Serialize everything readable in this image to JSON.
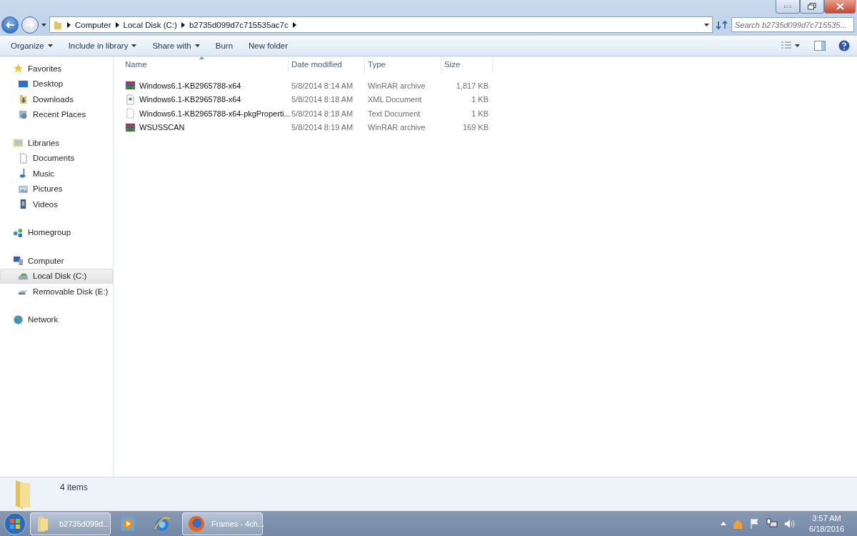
{
  "address_bar": {
    "crumbs": [
      "Computer",
      "Local Disk (C:)",
      "b2735d099d7c715535ac7c"
    ]
  },
  "search": {
    "placeholder": "Search b2735d099d7c715535..."
  },
  "toolbar": {
    "buttons": [
      {
        "label": "Organize",
        "dropdown": true
      },
      {
        "label": "Include in library",
        "dropdown": true
      },
      {
        "label": "Share with",
        "dropdown": true
      },
      {
        "label": "Burn",
        "dropdown": false
      },
      {
        "label": "New folder",
        "dropdown": false
      }
    ]
  },
  "nav": [
    {
      "label": "Favorites",
      "kind": "star",
      "selected": false,
      "children": [
        {
          "label": "Desktop",
          "kind": "desktop",
          "selected": false
        },
        {
          "label": "Downloads",
          "kind": "downloads",
          "selected": false
        },
        {
          "label": "Recent Places",
          "kind": "places",
          "selected": false
        }
      ]
    },
    {
      "label": "Libraries",
      "kind": "library",
      "selected": false,
      "children": [
        {
          "label": "Documents",
          "kind": "document",
          "selected": false
        },
        {
          "label": "Music",
          "kind": "music",
          "selected": false
        },
        {
          "label": "Pictures",
          "kind": "picture",
          "selected": false
        },
        {
          "label": "Videos",
          "kind": "video",
          "selected": false
        }
      ]
    },
    {
      "label": "Homegroup",
      "kind": "homegroup",
      "selected": false
    },
    {
      "label": "Computer",
      "kind": "computer",
      "selected": false,
      "children": [
        {
          "label": "Local Disk (C:)",
          "kind": "disk",
          "selected": true
        },
        {
          "label": "Removable Disk (E:)",
          "kind": "usb",
          "selected": false
        }
      ]
    },
    {
      "label": "Network",
      "kind": "network",
      "selected": false
    }
  ],
  "table": {
    "columns": [
      "Name",
      "Date modified",
      "Type",
      "Size"
    ],
    "rows": [
      {
        "kind": "rar",
        "name": "Windows6.1-KB2965788-x64",
        "date": "5/8/2014 8:14 AM",
        "type": "WinRAR archive",
        "size": "1,817 KB"
      },
      {
        "kind": "xml",
        "name": "Windows6.1-KB2965788-x64",
        "date": "5/8/2014 8:18 AM",
        "type": "XML Document",
        "size": "1 KB"
      },
      {
        "kind": "text",
        "name": "Windows6.1-KB2965788-x64-pkgProperti...",
        "date": "5/8/2014 8:18 AM",
        "type": "Text Document",
        "size": "1 KB"
      },
      {
        "kind": "rar",
        "name": "WSUSSCAN",
        "date": "5/8/2014 8:19 AM",
        "type": "WinRAR archive",
        "size": "169 KB"
      }
    ]
  },
  "details_pane": {
    "count": "4 items"
  },
  "taskbar": {
    "items": [
      {
        "kind": "folder",
        "label": "b2735d099d..."
      },
      {
        "kind": "media"
      },
      {
        "kind": "ie"
      },
      {
        "kind": "firefox",
        "label": "Frames - 4ch..."
      }
    ],
    "time": "3:57 AM",
    "date": "6/18/2016"
  }
}
